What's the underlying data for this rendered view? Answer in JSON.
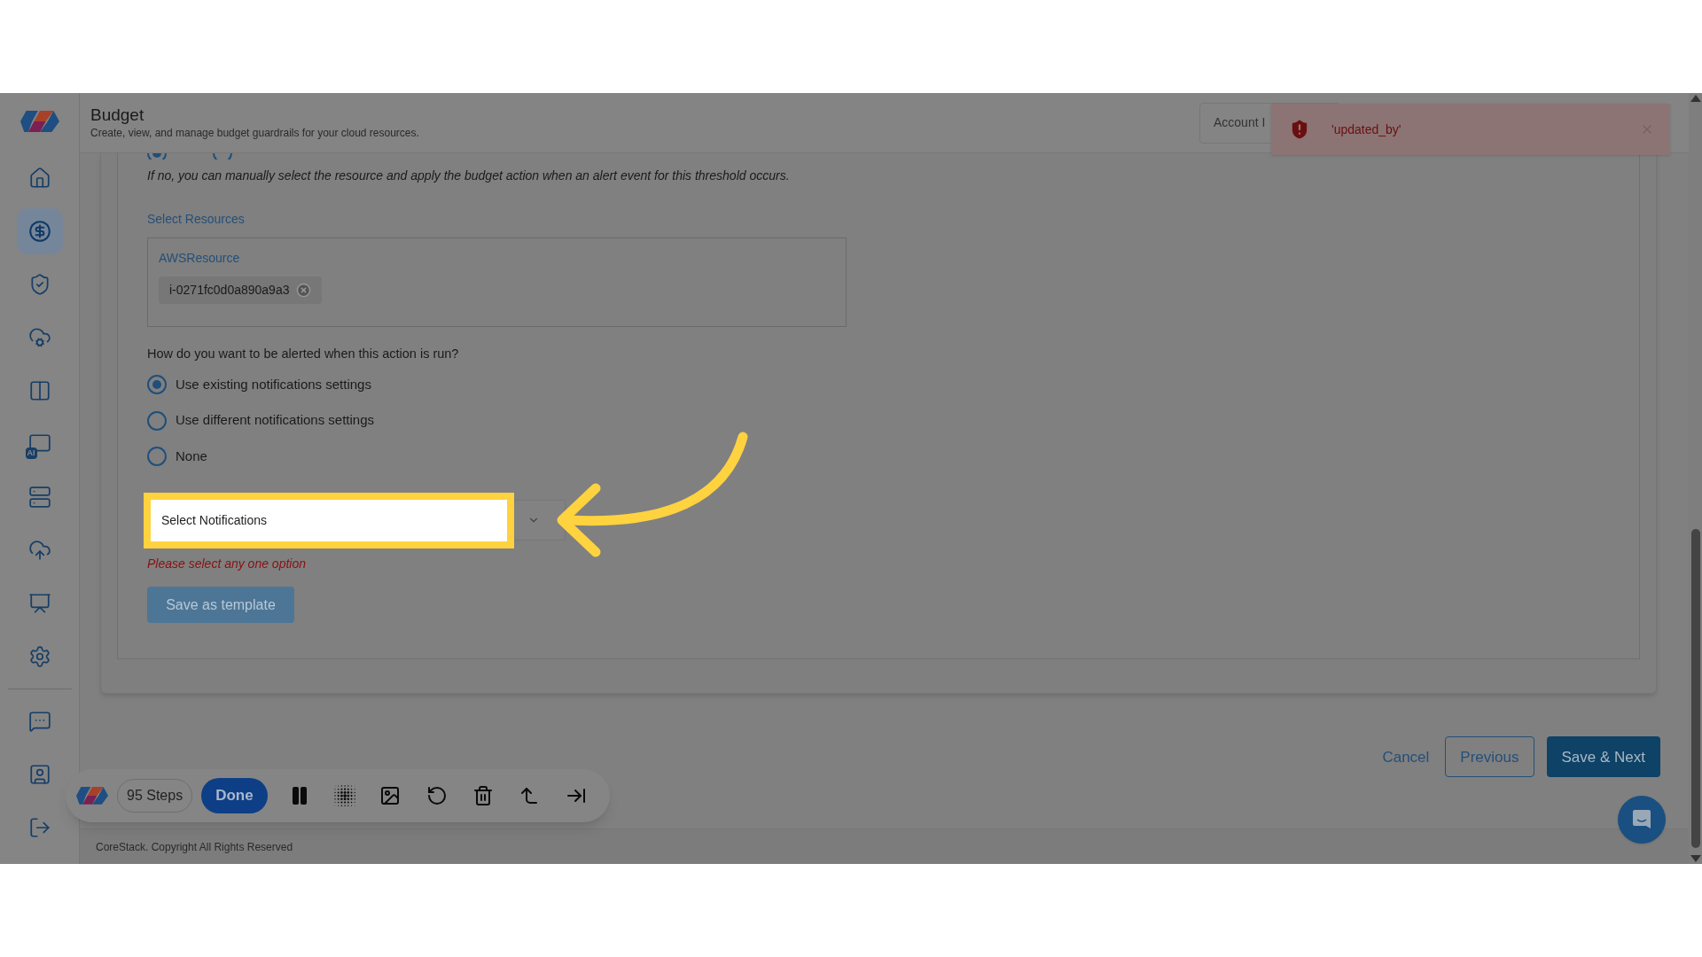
{
  "sidebar": {
    "items": [
      {
        "selected": false
      },
      {
        "selected": true
      },
      {
        "selected": false
      },
      {
        "selected": false
      },
      {
        "selected": false
      },
      {
        "selected": false,
        "icon_text": "AI"
      },
      {
        "selected": false
      },
      {
        "selected": false
      },
      {
        "selected": false
      },
      {
        "selected": false
      }
    ],
    "bottom_items": [
      {
        "selected": false
      },
      {
        "selected": false
      },
      {
        "selected": false
      }
    ]
  },
  "header": {
    "title": "Budget",
    "subtitle": "Create, view, and manage budget guardrails for your cloud resources.",
    "account_field": "Account I"
  },
  "toast": {
    "message": "'updated_by'"
  },
  "form": {
    "top_radios": [
      {
        "selected": true
      },
      {
        "selected": false
      }
    ],
    "note": "If no, you can manually select the resource and apply the budget action when an alert event for this threshold occurs.",
    "resources_label": "Select Resources",
    "resource_group": "AWSResource",
    "resource_chips": [
      "i-0271fc0d0a890a9a3"
    ],
    "question": "How do you want to be alerted when this action is run?",
    "options": [
      {
        "label": "Use existing notifications settings",
        "selected": true
      },
      {
        "label": "Use different notifications settings",
        "selected": false
      },
      {
        "label": "None",
        "selected": false
      }
    ],
    "select": {
      "placeholder": "Select Notifications"
    },
    "error": "Please select any one option",
    "save_template": "Save as template"
  },
  "actions": {
    "cancel": "Cancel",
    "previous": "Previous",
    "next": "Save & Next"
  },
  "footer": "CoreStack. Copyright All Rights Reserved",
  "recorder": {
    "steps": "95 Steps",
    "done": "Done"
  }
}
